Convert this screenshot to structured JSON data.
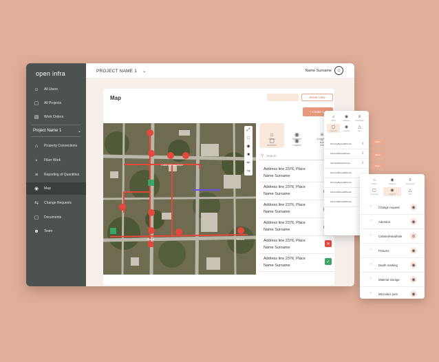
{
  "app": {
    "logo": "open infra"
  },
  "sidebar": {
    "items_top": [
      {
        "label": "All Users",
        "icon": "user-icon"
      },
      {
        "label": "All Projects",
        "icon": "document-icon"
      },
      {
        "label": "Work Orders",
        "icon": "clipboard-icon"
      }
    ],
    "project_selector": {
      "label": "Project Name 1"
    },
    "items_project": [
      {
        "label": "Property Connections",
        "icon": "home-icon"
      },
      {
        "label": "Fiber Work",
        "icon": "fiber-icon"
      },
      {
        "label": "Reporting of Quantities",
        "icon": "list-icon"
      },
      {
        "label": "Map",
        "icon": "map-pin-icon",
        "active": true
      },
      {
        "label": "Change Requests",
        "icon": "swap-icon"
      },
      {
        "label": "Documents",
        "icon": "document-icon"
      },
      {
        "label": "Team",
        "icon": "team-icon"
      }
    ]
  },
  "topbar": {
    "project": "PROJECT NAME 1",
    "user": "Name Surname"
  },
  "map_panel": {
    "title": "Map",
    "street_view": "Street View",
    "create_button": "+ Create e...",
    "map_labels": [
      "Cabinet/Handhole",
      "Plaza",
      "Bench"
    ],
    "tabs": [
      {
        "label": "Offers",
        "icon": "home-icon"
      },
      {
        "label": "Markers",
        "icon": "map-pin-icon"
      },
      {
        "label": "Quantities",
        "icon": "list-icon"
      },
      {
        "label": "Annexes",
        "icon": "document-icon"
      },
      {
        "label": "Legend",
        "icon": "eye-icon"
      },
      {
        "label": "Info",
        "icon": "warning-icon"
      }
    ],
    "search_placeholder": "Search",
    "addresses": [
      {
        "line1": "Address line 2376, Place",
        "line2": "Name Surname"
      },
      {
        "line1": "Address line 2376, Place",
        "line2": "Name Surname"
      },
      {
        "line1": "Address line 2376, Place",
        "line2": "Name Surname"
      },
      {
        "line1": "Address line 2376, Place",
        "line2": "Name Surname"
      },
      {
        "line1": "Address line 2376, Place",
        "line2": "Name Surname"
      },
      {
        "line1": "Address line 2376, Place",
        "line2": "Name Surname"
      }
    ]
  },
  "card1": {
    "tabs": [
      {
        "label": "Offers",
        "icon": "home-icon"
      },
      {
        "label": "Markers",
        "icon": "map-pin-icon"
      },
      {
        "label": "Quantities",
        "icon": "list-icon"
      },
      {
        "label": "Annexes",
        "icon": "document-icon",
        "active": true
      },
      {
        "label": "Legend",
        "icon": "eye-icon"
      },
      {
        "label": "Info",
        "icon": "warning-icon"
      }
    ],
    "rows": [
      {
        "text": "Filename/Beisetal/Beisetal",
        "button": "Delete"
      },
      {
        "text": "Filename/Beisetal/Delete",
        "button": "Delete"
      },
      {
        "text": "Abendtal/Beisetal/Simple",
        "button": "Delete"
      },
      {
        "text": "Filename/Beisetal/Beisetal",
        "button": ""
      },
      {
        "text": "Filename/Beisetal/Beisetal",
        "button": ""
      },
      {
        "text": "Filename/Beisetal/Beisetal",
        "button": ""
      },
      {
        "text": "Filename/Beisetal/Beisetal",
        "button": ""
      }
    ]
  },
  "card2": {
    "tabs": [
      {
        "label": "Offers",
        "icon": "home-icon"
      },
      {
        "label": "Markers",
        "icon": "map-pin-icon"
      },
      {
        "label": "Quantities",
        "icon": "list-icon"
      },
      {
        "label": "Annexes",
        "icon": "document-icon"
      },
      {
        "label": "Legend",
        "icon": "eye-icon",
        "active": true
      },
      {
        "label": "Info",
        "icon": "warning-icon"
      }
    ],
    "layers": [
      {
        "label": "Change request",
        "visible": true
      },
      {
        "label": "Adendon",
        "visible": true
      },
      {
        "label": "Cabinet/Handhole",
        "visible": false
      },
      {
        "label": "Pictures",
        "visible": true
      },
      {
        "label": "Depth marking",
        "visible": true
      },
      {
        "label": "Material storage",
        "visible": true
      },
      {
        "label": "Microduct joint",
        "visible": true
      }
    ]
  },
  "colors": {
    "background": "#e0ae98",
    "sidebar": "#4b524f",
    "accent": "#e7977c",
    "route": "#e5483b"
  }
}
